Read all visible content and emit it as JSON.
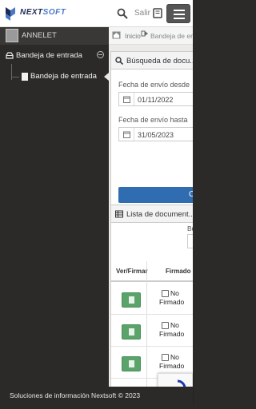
{
  "header": {
    "logo_text_a": "NEXT",
    "logo_text_b": "SOFT",
    "salir_label": "Salir"
  },
  "sidebar": {
    "user_name": "ANNELET",
    "section_label": "Bandeja de entrada",
    "sub_item_label": "Bandeja de entrada"
  },
  "breadcrumb": {
    "home": "Inicio",
    "current": "Bandeja de entra"
  },
  "search_panel": {
    "title": "Búsqueda de docu...",
    "fecha_desde_label": "Fecha de envío desde",
    "fecha_desde_value": "01/11/2022",
    "fecha_hasta_label": "Fecha de envío hasta",
    "fecha_hasta_value": "31/05/2023",
    "button_label": "C"
  },
  "list_panel": {
    "title": "Lista de document...",
    "search_label": "Bu",
    "columns": [
      "Ver/Firmar",
      "Firmado"
    ],
    "rows": [
      {
        "no": "No",
        "firmado": "Firmado"
      },
      {
        "no": "No",
        "firmado": "Firmado"
      },
      {
        "no": "No",
        "firmado": "Firmado"
      },
      {
        "no": "",
        "firmado": ""
      }
    ]
  },
  "footer": {
    "text": "Soluciones de información Nextsoft © 2023"
  },
  "colors": {
    "sidebar_bg": "#2c2a28",
    "primary_button": "#2f6db0",
    "view_button": "#5aa36a"
  }
}
